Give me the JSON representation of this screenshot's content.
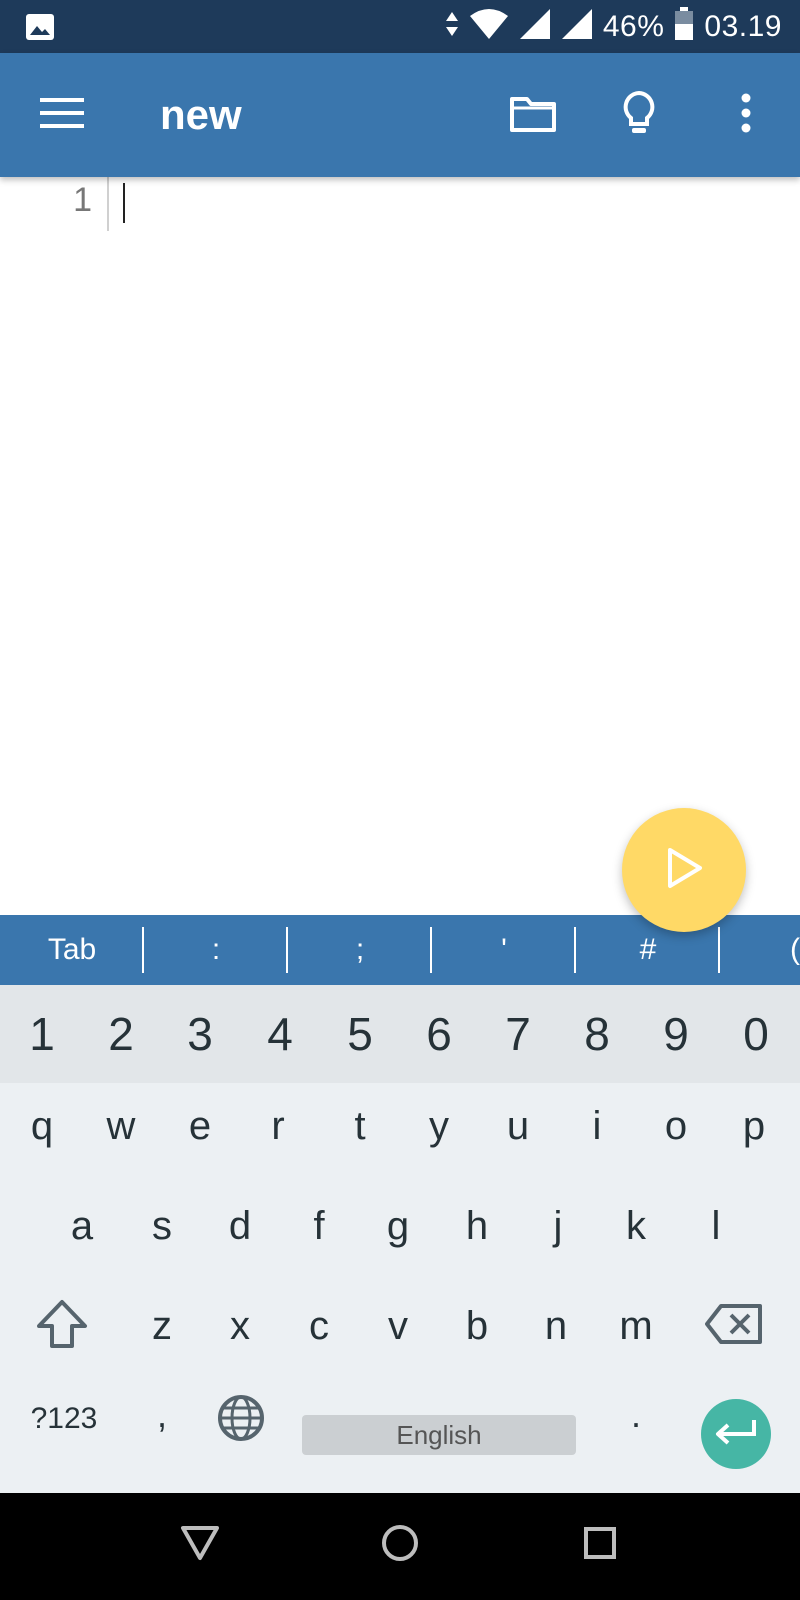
{
  "status_bar": {
    "battery": "46%",
    "time": "03.19",
    "icons": [
      "gallery-icon",
      "data-arrows-icon",
      "wifi-icon",
      "signal-icon",
      "signal-icon",
      "battery-icon"
    ]
  },
  "app_bar": {
    "title": "new",
    "icons": [
      "menu-icon",
      "folder-icon",
      "lightbulb-icon",
      "more-vert-icon"
    ],
    "color": "#3a76ad"
  },
  "editor": {
    "line_numbers": [
      "1"
    ],
    "content": ""
  },
  "fab": {
    "icon": "play-icon",
    "color": "#ffd966"
  },
  "symbol_bar": {
    "keys": [
      "Tab",
      ":",
      ";",
      "'",
      "#",
      "("
    ]
  },
  "keyboard": {
    "number_row": [
      "1",
      "2",
      "3",
      "4",
      "5",
      "6",
      "7",
      "8",
      "9",
      "0"
    ],
    "row1": [
      "q",
      "w",
      "e",
      "r",
      "t",
      "y",
      "u",
      "i",
      "o",
      "p"
    ],
    "row2": [
      "a",
      "s",
      "d",
      "f",
      "g",
      "h",
      "j",
      "k",
      "l"
    ],
    "row3": [
      "z",
      "x",
      "c",
      "v",
      "b",
      "n",
      "m"
    ],
    "symbols_key": "?123",
    "comma_key": ",",
    "period_key": ".",
    "space_label": "English",
    "icons": [
      "shift-icon",
      "backspace-icon",
      "globe-icon",
      "enter-icon"
    ],
    "enter_color": "#46b6a5"
  },
  "nav_bar": {
    "icons": [
      "back-icon",
      "home-icon",
      "recents-icon"
    ]
  }
}
